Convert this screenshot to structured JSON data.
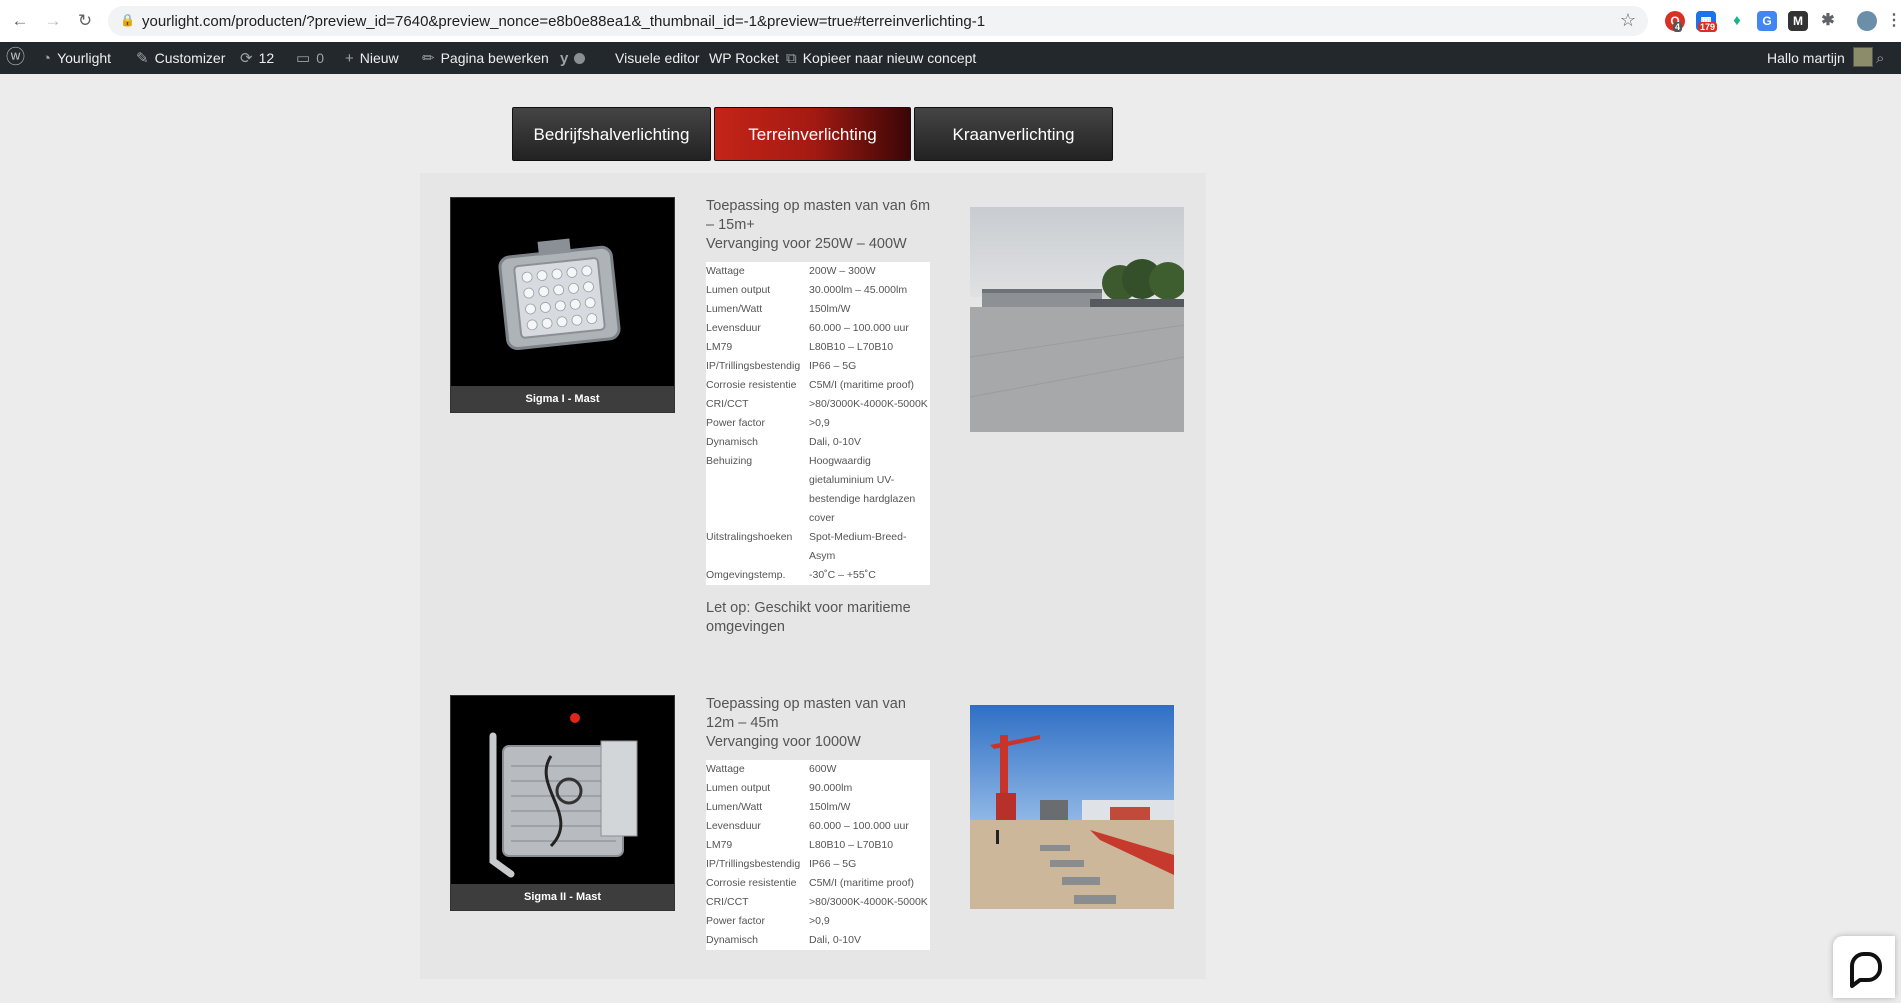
{
  "browser": {
    "url": "yourlight.com/producten/?preview_id=7640&preview_nonce=e8b0e88ea1&_thumbnail_id=-1&preview=true#terreinverlichting-1",
    "extension_badges": [
      "4",
      "179"
    ]
  },
  "adminbar": {
    "site": "Yourlight",
    "customizer": "Customizer",
    "updates": "12",
    "comments": "0",
    "new": "Nieuw",
    "edit": "Pagina bewerken",
    "visual_editor": "Visuele editor",
    "wp_rocket": "WP Rocket",
    "copy_draft": "Kopieer naar nieuw concept",
    "greeting": "Hallo martijn"
  },
  "tabs": [
    {
      "label": "Bedrijfshalverlichting",
      "active": false
    },
    {
      "label": "Terreinverlichting",
      "active": true
    },
    {
      "label": "Kraanverlichting",
      "active": false
    }
  ],
  "products": [
    {
      "caption": "Sigma I - Mast",
      "headline_1": "Toepassing op masten van van 6m – 15m+",
      "headline_2": "Vervanging voor 250W – 400W",
      "specs": [
        {
          "k": "Wattage",
          "v": "200W – 300W"
        },
        {
          "k": "Lumen output",
          "v": "30.000lm – 45.000lm"
        },
        {
          "k": "Lumen/Watt",
          "v": "150lm/W"
        },
        {
          "k": "Levensduur",
          "v": "60.000 – 100.000 uur"
        },
        {
          "k": "LM79",
          "v": "L80B10 – L70B10"
        },
        {
          "k": "IP/Trillingsbestendig",
          "v": "IP66 – 5G"
        },
        {
          "k": "Corrosie resistentie",
          "v": "C5M/I (maritime proof)"
        },
        {
          "k": "CRI/CCT",
          "v": ">80/3000K-4000K-5000K"
        },
        {
          "k": "Power factor",
          "v": ">0,9"
        },
        {
          "k": "Dynamisch",
          "v": "Dali, 0-10V"
        },
        {
          "k": "Behuizing",
          "v": "Hoogwaardig gietaluminium UV-bestendige hardglazen cover"
        },
        {
          "k": "Uitstralingshoeken",
          "v": "Spot-Medium-Breed-Asym"
        },
        {
          "k": "Omgevingstemp.",
          "v": "-30˚C – +55˚C"
        }
      ],
      "note": "Let op: Geschikt voor maritieme omgevingen"
    },
    {
      "caption": "Sigma II - Mast",
      "headline_1": "Toepassing op masten van van 12m – 45m",
      "headline_2": "Vervanging voor 1000W",
      "specs": [
        {
          "k": "Wattage",
          "v": "600W"
        },
        {
          "k": "Lumen output",
          "v": "90.000lm"
        },
        {
          "k": "Lumen/Watt",
          "v": "150lm/W"
        },
        {
          "k": "Levensduur",
          "v": "60.000 – 100.000 uur"
        },
        {
          "k": "LM79",
          "v": "L80B10 – L70B10"
        },
        {
          "k": "IP/Trillingsbestendig",
          "v": "IP66 – 5G"
        },
        {
          "k": "Corrosie resistentie",
          "v": "C5M/I (maritime proof)"
        },
        {
          "k": "CRI/CCT",
          "v": ">80/3000K-4000K-5000K"
        },
        {
          "k": "Power factor",
          "v": ">0,9"
        },
        {
          "k": "Dynamisch",
          "v": "Dali, 0-10V"
        }
      ]
    }
  ],
  "colors": {
    "accent": "#c52418",
    "adminbar": "#23282d"
  }
}
